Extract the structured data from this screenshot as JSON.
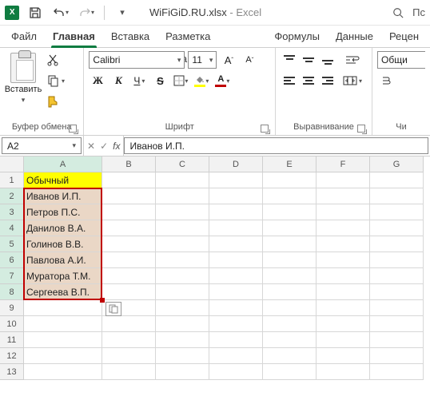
{
  "title": {
    "filename": "WiFiGiD.RU.xlsx",
    "app": "Excel",
    "search_hint": "Пс"
  },
  "tabs": {
    "file": "Файл",
    "home": "Главная",
    "insert": "Вставка",
    "layout": "Разметка страницы",
    "formulas": "Формулы",
    "data": "Данные",
    "review": "Рецен"
  },
  "ribbon": {
    "clipboard": {
      "paste": "Вставить",
      "group_label": "Буфер обмена"
    },
    "font": {
      "group_label": "Шрифт",
      "name": "Calibri",
      "size": "11",
      "bold": "Ж",
      "italic": "К",
      "underline": "Ч",
      "strike": "S"
    },
    "alignment": {
      "group_label": "Выравнивание"
    },
    "number": {
      "group_label": "Чи",
      "format": "Общи"
    }
  },
  "namebox": "A2",
  "formula": "Иванов И.П.",
  "columns": [
    "A",
    "B",
    "C",
    "D",
    "E",
    "F",
    "G"
  ],
  "rows": [
    "1",
    "2",
    "3",
    "4",
    "5",
    "6",
    "7",
    "8",
    "9",
    "10",
    "11",
    "12",
    "13"
  ],
  "cells": {
    "A1": "Обычный",
    "A2": "Иванов И.П.",
    "A3": "Петров П.С.",
    "A4": "Данилов В.А.",
    "A5": "Голинов В.В.",
    "A6": "Павлова А.И.",
    "A7": "Муратора Т.М.",
    "A8": "Сергеева В.П."
  },
  "selection": {
    "range": "A2:A8",
    "header_range": "A1"
  }
}
